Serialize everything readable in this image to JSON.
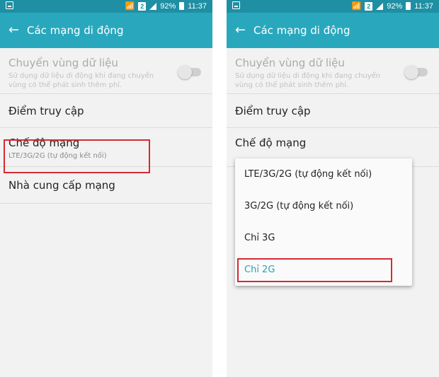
{
  "status_bar": {
    "sim": "2",
    "battery": "92%",
    "time": "11:37"
  },
  "appbar": {
    "title": "Các mạng di động"
  },
  "settings": {
    "roaming_title": "Chuyển vùng dữ liệu",
    "roaming_desc": "Sử dụng dữ liệu di động khi đang chuyển vùng có thể phát sinh thêm phí.",
    "apn_title": "Điểm truy cập",
    "mode_title": "Chế độ mạng",
    "mode_value": "LTE/3G/2G (tự động kết nối)",
    "carrier_title": "Nhà cung cấp mạng"
  },
  "dropdown": {
    "options": [
      "LTE/3G/2G (tự động kết nối)",
      "3G/2G (tự động kết nối)",
      "Chỉ 3G",
      "Chỉ 2G"
    ],
    "selected_index": 3
  },
  "colors": {
    "status_bar": "#1f8fa3",
    "app_bar": "#29a8bd",
    "highlight": "#d62a32",
    "selected_text": "#29a0b5"
  }
}
